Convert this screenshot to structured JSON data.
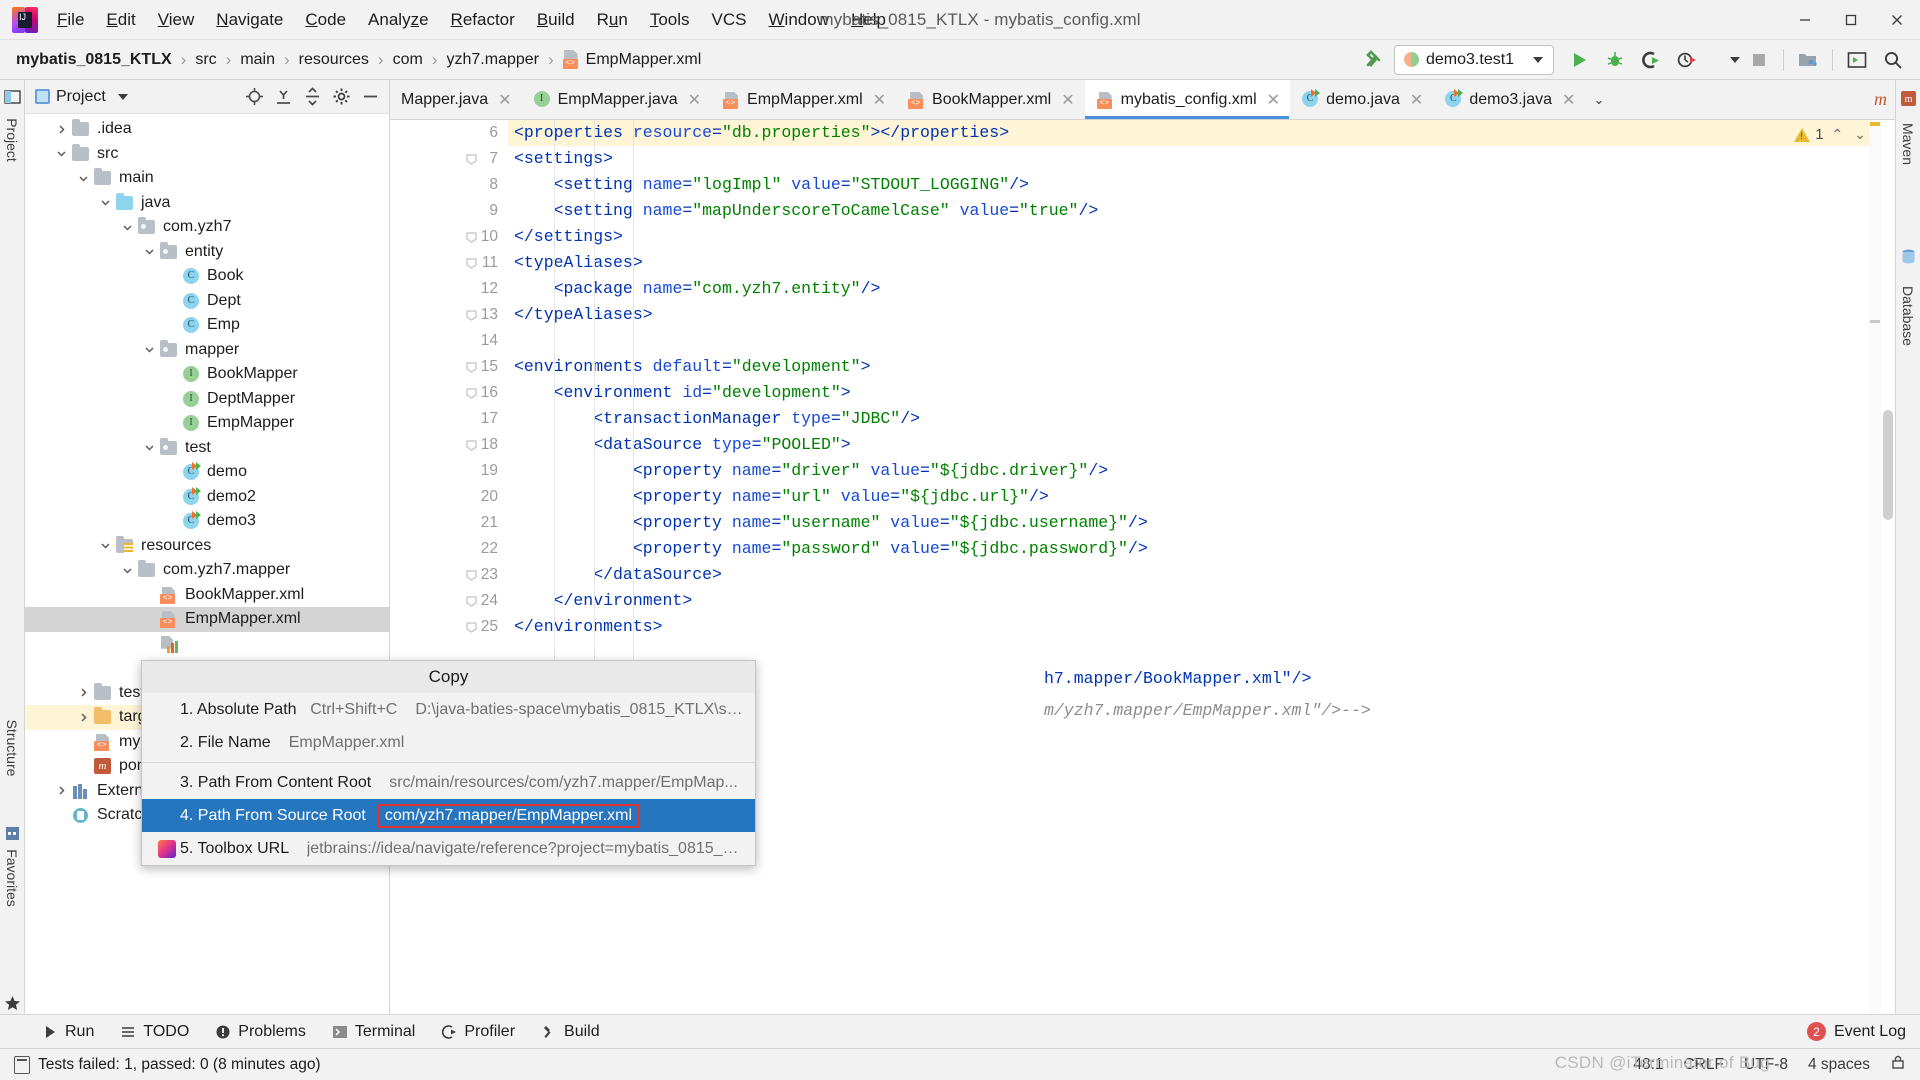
{
  "window": {
    "title": "mybatis_0815_KTLX - mybatis_config.xml",
    "logo_name": "intellij-idea-logo"
  },
  "menubar": {
    "items": [
      "File",
      "Edit",
      "View",
      "Navigate",
      "Code",
      "Analyze",
      "Refactor",
      "Build",
      "Run",
      "Tools",
      "VCS",
      "Window",
      "Help"
    ]
  },
  "window_controls": {
    "minimize": "—",
    "maximize": "□",
    "close": "✕"
  },
  "breadcrumb": {
    "items": [
      "mybatis_0815_KTLX",
      "src",
      "main",
      "resources",
      "com",
      "yzh7.mapper",
      "EmpMapper.xml"
    ],
    "separator": "›"
  },
  "toolbar": {
    "run_config": "demo3.test1",
    "build_label": "build-hammer-icon",
    "buttons": [
      "run-button",
      "debug-button",
      "run-with-coverage-button",
      "profile-button",
      "stop-button",
      "project-structure-button",
      "terminal-button",
      "search-everywhere-button"
    ]
  },
  "project_panel": {
    "title": "Project",
    "actions": [
      "locate-icon",
      "expand-all-icon",
      "collapse-all-icon",
      "settings-icon",
      "hide-icon"
    ],
    "tree": [
      {
        "label": ".idea",
        "depth": 1,
        "icon": "folder",
        "arrow": "collapsed"
      },
      {
        "label": "src",
        "depth": 1,
        "icon": "folder",
        "arrow": "expanded"
      },
      {
        "label": "main",
        "depth": 2,
        "icon": "folder",
        "arrow": "expanded"
      },
      {
        "label": "java",
        "depth": 3,
        "icon": "folder-source",
        "arrow": "expanded"
      },
      {
        "label": "com.yzh7",
        "depth": 4,
        "icon": "folder-package",
        "arrow": "expanded"
      },
      {
        "label": "entity",
        "depth": 5,
        "icon": "folder-package",
        "arrow": "expanded"
      },
      {
        "label": "Book",
        "depth": 6,
        "icon": "class",
        "arrow": "none"
      },
      {
        "label": "Dept",
        "depth": 6,
        "icon": "class",
        "arrow": "none"
      },
      {
        "label": "Emp",
        "depth": 6,
        "icon": "class",
        "arrow": "none"
      },
      {
        "label": "mapper",
        "depth": 5,
        "icon": "folder-package",
        "arrow": "expanded"
      },
      {
        "label": "BookMapper",
        "depth": 6,
        "icon": "interface",
        "arrow": "none"
      },
      {
        "label": "DeptMapper",
        "depth": 6,
        "icon": "interface",
        "arrow": "none"
      },
      {
        "label": "EmpMapper",
        "depth": 6,
        "icon": "interface",
        "arrow": "none"
      },
      {
        "label": "test",
        "depth": 5,
        "icon": "folder-package",
        "arrow": "expanded"
      },
      {
        "label": "demo",
        "depth": 6,
        "icon": "class-runnable",
        "arrow": "none"
      },
      {
        "label": "demo2",
        "depth": 6,
        "icon": "class-runnable",
        "arrow": "none"
      },
      {
        "label": "demo3",
        "depth": 6,
        "icon": "class-runnable",
        "arrow": "none"
      },
      {
        "label": "resources",
        "depth": 3,
        "icon": "folder-resource",
        "arrow": "expanded"
      },
      {
        "label": "com.yzh7.mapper",
        "depth": 4,
        "icon": "folder",
        "arrow": "expanded"
      },
      {
        "label": "BookMapper.xml",
        "depth": 5,
        "icon": "xml",
        "arrow": "none"
      },
      {
        "label": "EmpMapper.xml",
        "depth": 5,
        "icon": "xml",
        "arrow": "none",
        "selected": true
      },
      {
        "label": "",
        "depth": 5,
        "icon": "chart",
        "arrow": "none"
      },
      {
        "label": "",
        "depth": 5,
        "icon": "xml",
        "arrow": "none"
      },
      {
        "label": "test",
        "depth": 2,
        "icon": "folder",
        "arrow": "collapsed"
      },
      {
        "label": "target",
        "depth": 2,
        "icon": "folder-target",
        "arrow": "collapsed",
        "highlight": true
      },
      {
        "label": "mybatis",
        "depth": 2,
        "icon": "xml",
        "arrow": "none"
      },
      {
        "label": "pom.xml",
        "depth": 2,
        "icon": "maven",
        "arrow": "none"
      },
      {
        "label": "External Libr",
        "depth": 1,
        "icon": "library",
        "arrow": "collapsed"
      },
      {
        "label": "Scratches and Consoles",
        "depth": 1,
        "icon": "scratch",
        "arrow": "none"
      }
    ]
  },
  "editor_tabs": [
    {
      "label": "Mapper.java",
      "icon": "java-interface",
      "clipped": true,
      "active": false
    },
    {
      "label": "EmpMapper.java",
      "icon": "java-interface",
      "active": false
    },
    {
      "label": "EmpMapper.xml",
      "icon": "xml",
      "active": false
    },
    {
      "label": "BookMapper.xml",
      "icon": "xml",
      "active": false
    },
    {
      "label": "mybatis_config.xml",
      "icon": "xml",
      "active": true
    },
    {
      "label": "demo.java",
      "icon": "java-runnable",
      "active": false
    },
    {
      "label": "demo3.java",
      "icon": "java-runnable",
      "active": false
    }
  ],
  "editor": {
    "warning_count": "1",
    "first_line_number": 6,
    "lines": [
      {
        "n": 6,
        "fold": false,
        "highlight": true,
        "tokens": [
          {
            "t": "<properties ",
            "c": "tagc"
          },
          {
            "t": "resource",
            "c": "attr"
          },
          {
            "t": "=",
            "c": "pun"
          },
          {
            "t": "\"db.properties\"",
            "c": "str"
          },
          {
            "t": "></properties>",
            "c": "tagc"
          }
        ],
        "indent": 0
      },
      {
        "n": 7,
        "fold": true,
        "tokens": [
          {
            "t": "<settings>",
            "c": "tagc"
          }
        ],
        "indent": 0
      },
      {
        "n": 8,
        "fold": false,
        "tokens": [
          {
            "t": "    <setting ",
            "c": "tagc"
          },
          {
            "t": "name",
            "c": "attr"
          },
          {
            "t": "=",
            "c": "pun"
          },
          {
            "t": "\"logImpl\"",
            "c": "str"
          },
          {
            "t": " ",
            "c": "pun"
          },
          {
            "t": "value",
            "c": "attr"
          },
          {
            "t": "=",
            "c": "pun"
          },
          {
            "t": "\"STDOUT_LOGGING\"",
            "c": "str"
          },
          {
            "t": "/>",
            "c": "tagc"
          }
        ],
        "indent": 1
      },
      {
        "n": 9,
        "fold": false,
        "tokens": [
          {
            "t": "    <setting ",
            "c": "tagc"
          },
          {
            "t": "name",
            "c": "attr"
          },
          {
            "t": "=",
            "c": "pun"
          },
          {
            "t": "\"mapUnderscoreToCamelCase\"",
            "c": "str"
          },
          {
            "t": " ",
            "c": "pun"
          },
          {
            "t": "value",
            "c": "attr"
          },
          {
            "t": "=",
            "c": "pun"
          },
          {
            "t": "\"true\"",
            "c": "str"
          },
          {
            "t": "/>",
            "c": "tagc"
          }
        ],
        "indent": 1
      },
      {
        "n": 10,
        "fold": true,
        "tokens": [
          {
            "t": "</settings>",
            "c": "tagc"
          }
        ],
        "indent": 0
      },
      {
        "n": 11,
        "fold": true,
        "tokens": [
          {
            "t": "<typeAliases>",
            "c": "tagc"
          }
        ],
        "indent": 0
      },
      {
        "n": 12,
        "fold": false,
        "tokens": [
          {
            "t": "    <package ",
            "c": "tagc"
          },
          {
            "t": "name",
            "c": "attr"
          },
          {
            "t": "=",
            "c": "pun"
          },
          {
            "t": "\"com.yzh7.entity\"",
            "c": "str"
          },
          {
            "t": "/>",
            "c": "tagc"
          }
        ],
        "indent": 1
      },
      {
        "n": 13,
        "fold": true,
        "tokens": [
          {
            "t": "</typeAliases>",
            "c": "tagc"
          }
        ],
        "indent": 0
      },
      {
        "n": 14,
        "fold": false,
        "tokens": [
          {
            "t": "",
            "c": "tagc"
          }
        ],
        "indent": 0
      },
      {
        "n": 15,
        "fold": true,
        "tokens": [
          {
            "t": "<environments ",
            "c": "tagc"
          },
          {
            "t": "default",
            "c": "attr"
          },
          {
            "t": "=",
            "c": "pun"
          },
          {
            "t": "\"development\"",
            "c": "str"
          },
          {
            "t": ">",
            "c": "tagc"
          }
        ],
        "indent": 0
      },
      {
        "n": 16,
        "fold": true,
        "tokens": [
          {
            "t": "    <environment ",
            "c": "tagc"
          },
          {
            "t": "id",
            "c": "attr"
          },
          {
            "t": "=",
            "c": "pun"
          },
          {
            "t": "\"development\"",
            "c": "str"
          },
          {
            "t": ">",
            "c": "tagc"
          }
        ],
        "indent": 1
      },
      {
        "n": 17,
        "fold": false,
        "tokens": [
          {
            "t": "        <transactionManager ",
            "c": "tagc"
          },
          {
            "t": "type",
            "c": "attr"
          },
          {
            "t": "=",
            "c": "pun"
          },
          {
            "t": "\"JDBC\"",
            "c": "str"
          },
          {
            "t": "/>",
            "c": "tagc"
          }
        ],
        "indent": 2
      },
      {
        "n": 18,
        "fold": true,
        "tokens": [
          {
            "t": "        <dataSource ",
            "c": "tagc"
          },
          {
            "t": "type",
            "c": "attr"
          },
          {
            "t": "=",
            "c": "pun"
          },
          {
            "t": "\"POOLED\"",
            "c": "str"
          },
          {
            "t": ">",
            "c": "tagc"
          }
        ],
        "indent": 2
      },
      {
        "n": 19,
        "fold": false,
        "tokens": [
          {
            "t": "            <property ",
            "c": "tagc"
          },
          {
            "t": "name",
            "c": "attr"
          },
          {
            "t": "=",
            "c": "pun"
          },
          {
            "t": "\"driver\"",
            "c": "str"
          },
          {
            "t": " ",
            "c": "pun"
          },
          {
            "t": "value",
            "c": "attr"
          },
          {
            "t": "=",
            "c": "pun"
          },
          {
            "t": "\"${jdbc.driver}\"",
            "c": "str"
          },
          {
            "t": "/>",
            "c": "tagc"
          }
        ],
        "indent": 3
      },
      {
        "n": 20,
        "fold": false,
        "tokens": [
          {
            "t": "            <property ",
            "c": "tagc"
          },
          {
            "t": "name",
            "c": "attr"
          },
          {
            "t": "=",
            "c": "pun"
          },
          {
            "t": "\"url\"",
            "c": "str"
          },
          {
            "t": " ",
            "c": "pun"
          },
          {
            "t": "value",
            "c": "attr"
          },
          {
            "t": "=",
            "c": "pun"
          },
          {
            "t": "\"${jdbc.url}\"",
            "c": "str"
          },
          {
            "t": "/>",
            "c": "tagc"
          }
        ],
        "indent": 3
      },
      {
        "n": 21,
        "fold": false,
        "tokens": [
          {
            "t": "            <property ",
            "c": "tagc"
          },
          {
            "t": "name",
            "c": "attr"
          },
          {
            "t": "=",
            "c": "pun"
          },
          {
            "t": "\"username\"",
            "c": "str"
          },
          {
            "t": " ",
            "c": "pun"
          },
          {
            "t": "value",
            "c": "attr"
          },
          {
            "t": "=",
            "c": "pun"
          },
          {
            "t": "\"${jdbc.username}\"",
            "c": "str"
          },
          {
            "t": "/>",
            "c": "tagc"
          }
        ],
        "indent": 3
      },
      {
        "n": 22,
        "fold": false,
        "tokens": [
          {
            "t": "            <property ",
            "c": "tagc"
          },
          {
            "t": "name",
            "c": "attr"
          },
          {
            "t": "=",
            "c": "pun"
          },
          {
            "t": "\"password\"",
            "c": "str"
          },
          {
            "t": " ",
            "c": "pun"
          },
          {
            "t": "value",
            "c": "attr"
          },
          {
            "t": "=",
            "c": "pun"
          },
          {
            "t": "\"${jdbc.password}\"",
            "c": "str"
          },
          {
            "t": "/>",
            "c": "tagc"
          }
        ],
        "indent": 3
      },
      {
        "n": 23,
        "fold": true,
        "tokens": [
          {
            "t": "        </dataSource>",
            "c": "tagc"
          }
        ],
        "indent": 2
      },
      {
        "n": 24,
        "fold": true,
        "tokens": [
          {
            "t": "    </environment>",
            "c": "tagc"
          }
        ],
        "indent": 1
      },
      {
        "n": 25,
        "fold": true,
        "tokens": [
          {
            "t": "</environments>",
            "c": "tagc"
          }
        ],
        "indent": 0
      }
    ],
    "partial_lines": [
      {
        "tokens": [
          {
            "t": "h7.mapper/BookMapper.xml\"/>",
            "c": "tagc"
          }
        ]
      },
      {
        "tokens": [
          {
            "t": "m/yzh7.mapper/EmpMapper.xml\"/>-->",
            "c": "cmt"
          }
        ]
      }
    ]
  },
  "context_menu": {
    "title": "Copy",
    "items": [
      {
        "index": "1.",
        "label": "Absolute Path",
        "shortcut": "Ctrl+Shift+C",
        "value": "D:\\java-baties-space\\mybatis_0815_KTLX\\src\\...",
        "icon": ""
      },
      {
        "index": "2.",
        "label": "File Name",
        "shortcut": "",
        "value": "EmpMapper.xml",
        "icon": ""
      },
      {
        "index": "3.",
        "label": "Path From Content Root",
        "shortcut": "",
        "value": "src/main/resources/com/yzh7.mapper/EmpMap...",
        "icon": ""
      },
      {
        "index": "4.",
        "label": "Path From Source Root",
        "shortcut": "",
        "value": "com/yzh7.mapper/EmpMapper.xml",
        "icon": "",
        "selected": true,
        "boxed": true
      },
      {
        "index": "5.",
        "label": "Toolbox URL",
        "shortcut": "",
        "value": "jetbrains://idea/navigate/reference?project=mybatis_0815_K...",
        "icon": "toolbox-icon"
      }
    ]
  },
  "left_rail": {
    "labels": [
      "Project",
      "Structure",
      "Favorites"
    ]
  },
  "right_rail": {
    "labels": [
      "Maven",
      "Database"
    ]
  },
  "tool_window_bar": {
    "items": [
      {
        "label": "Run",
        "icon": "run-icon"
      },
      {
        "label": "TODO",
        "icon": "todo-icon"
      },
      {
        "label": "Problems",
        "icon": "problems-icon"
      },
      {
        "label": "Terminal",
        "icon": "terminal-icon"
      },
      {
        "label": "Profiler",
        "icon": "profiler-icon"
      },
      {
        "label": "Build",
        "icon": "build-icon"
      }
    ],
    "event_log": {
      "label": "Event Log",
      "count": "2"
    }
  },
  "status_bar": {
    "message": "Tests failed: 1, passed: 0 (8 minutes ago)",
    "caret": "48:1",
    "line_separator": "CRLF",
    "encoding": "UTF-8",
    "indent": "4 spaces",
    "watermark": "CSDN @iTerminator of Bug"
  }
}
